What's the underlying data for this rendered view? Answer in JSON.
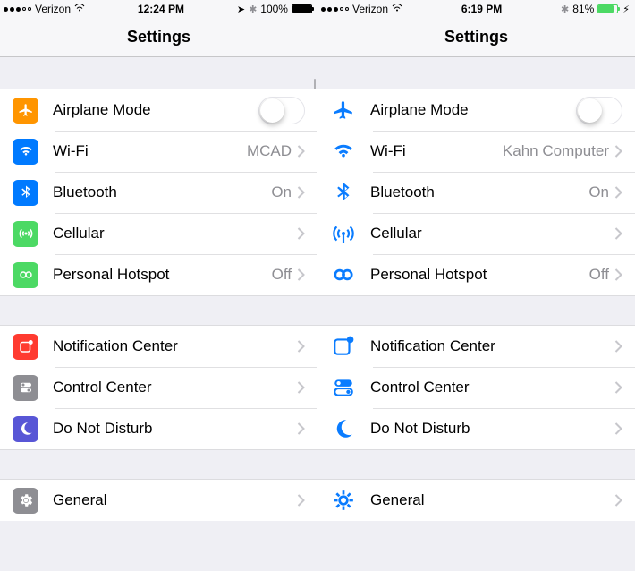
{
  "left": {
    "carrier": "Verizon",
    "time": "12:24 PM",
    "battery_pct": "100%",
    "title": "Settings",
    "rows": {
      "airplane": "Airplane Mode",
      "wifi": "Wi-Fi",
      "wifi_value": "MCAD",
      "bluetooth": "Bluetooth",
      "bluetooth_value": "On",
      "cellular": "Cellular",
      "hotspot": "Personal Hotspot",
      "hotspot_value": "Off",
      "notification": "Notification Center",
      "control": "Control Center",
      "dnd": "Do Not Disturb",
      "general": "General"
    }
  },
  "right": {
    "carrier": "Verizon",
    "time": "6:19 PM",
    "battery_pct": "81%",
    "title": "Settings",
    "rows": {
      "airplane": "Airplane Mode",
      "wifi": "Wi-Fi",
      "wifi_value": "Kahn Computer",
      "bluetooth": "Bluetooth",
      "bluetooth_value": "On",
      "cellular": "Cellular",
      "hotspot": "Personal Hotspot",
      "hotspot_value": "Off",
      "notification": "Notification Center",
      "control": "Control Center",
      "dnd": "Do Not Disturb",
      "general": "General"
    }
  }
}
